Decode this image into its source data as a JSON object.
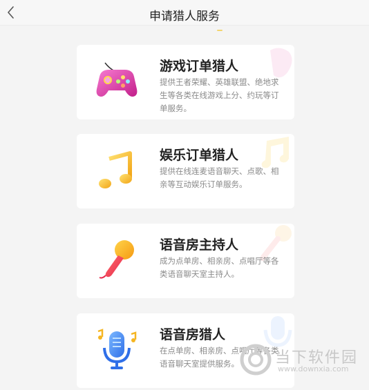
{
  "header": {
    "title": "申请猎人服务",
    "back_icon": "chevron-left-icon"
  },
  "cards": [
    {
      "title": "游戏订单猎人",
      "description": "提供王者荣耀、英雄联盟、绝地求生等各类在线游戏上分、约玩等订单服务。",
      "icon": "gamepad-icon",
      "accent": "#e93fae"
    },
    {
      "title": "娱乐订单猎人",
      "description": "提供在线连麦语音聊天、点歌、相亲等互动娱乐订单服务。",
      "icon": "music-note-icon",
      "accent": "#f6c431"
    },
    {
      "title": "语音房主持人",
      "description": "成为点单房、相亲房、点唱厅等各类语音聊天室主持人。",
      "icon": "microphone-icon",
      "accent": "#f5a623"
    },
    {
      "title": "语音房猎人",
      "description": "在点单房、相亲房、点唱厅等各类语音聊天室提供服务。",
      "icon": "voice-microphone-icon",
      "accent": "#3f8af5"
    }
  ],
  "watermark": {
    "text": "当下软件园",
    "url": "www.downxia.com"
  }
}
